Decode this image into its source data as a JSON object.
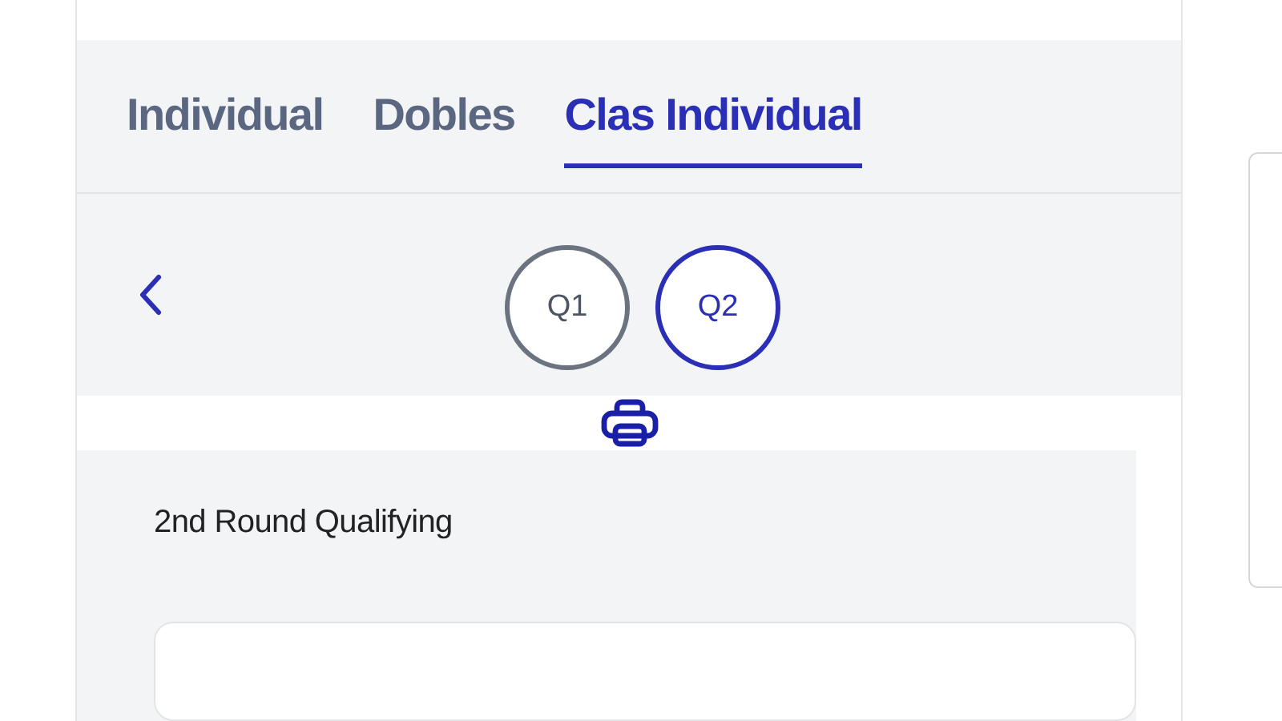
{
  "tabs": [
    {
      "label": "Individual",
      "selected": false
    },
    {
      "label": "Dobles",
      "selected": false
    },
    {
      "label": "Clas Individual",
      "selected": true
    }
  ],
  "rounds": [
    {
      "label": "Q1",
      "selected": false
    },
    {
      "label": "Q2",
      "selected": true
    }
  ],
  "section": {
    "title": "2nd Round Qualifying"
  }
}
